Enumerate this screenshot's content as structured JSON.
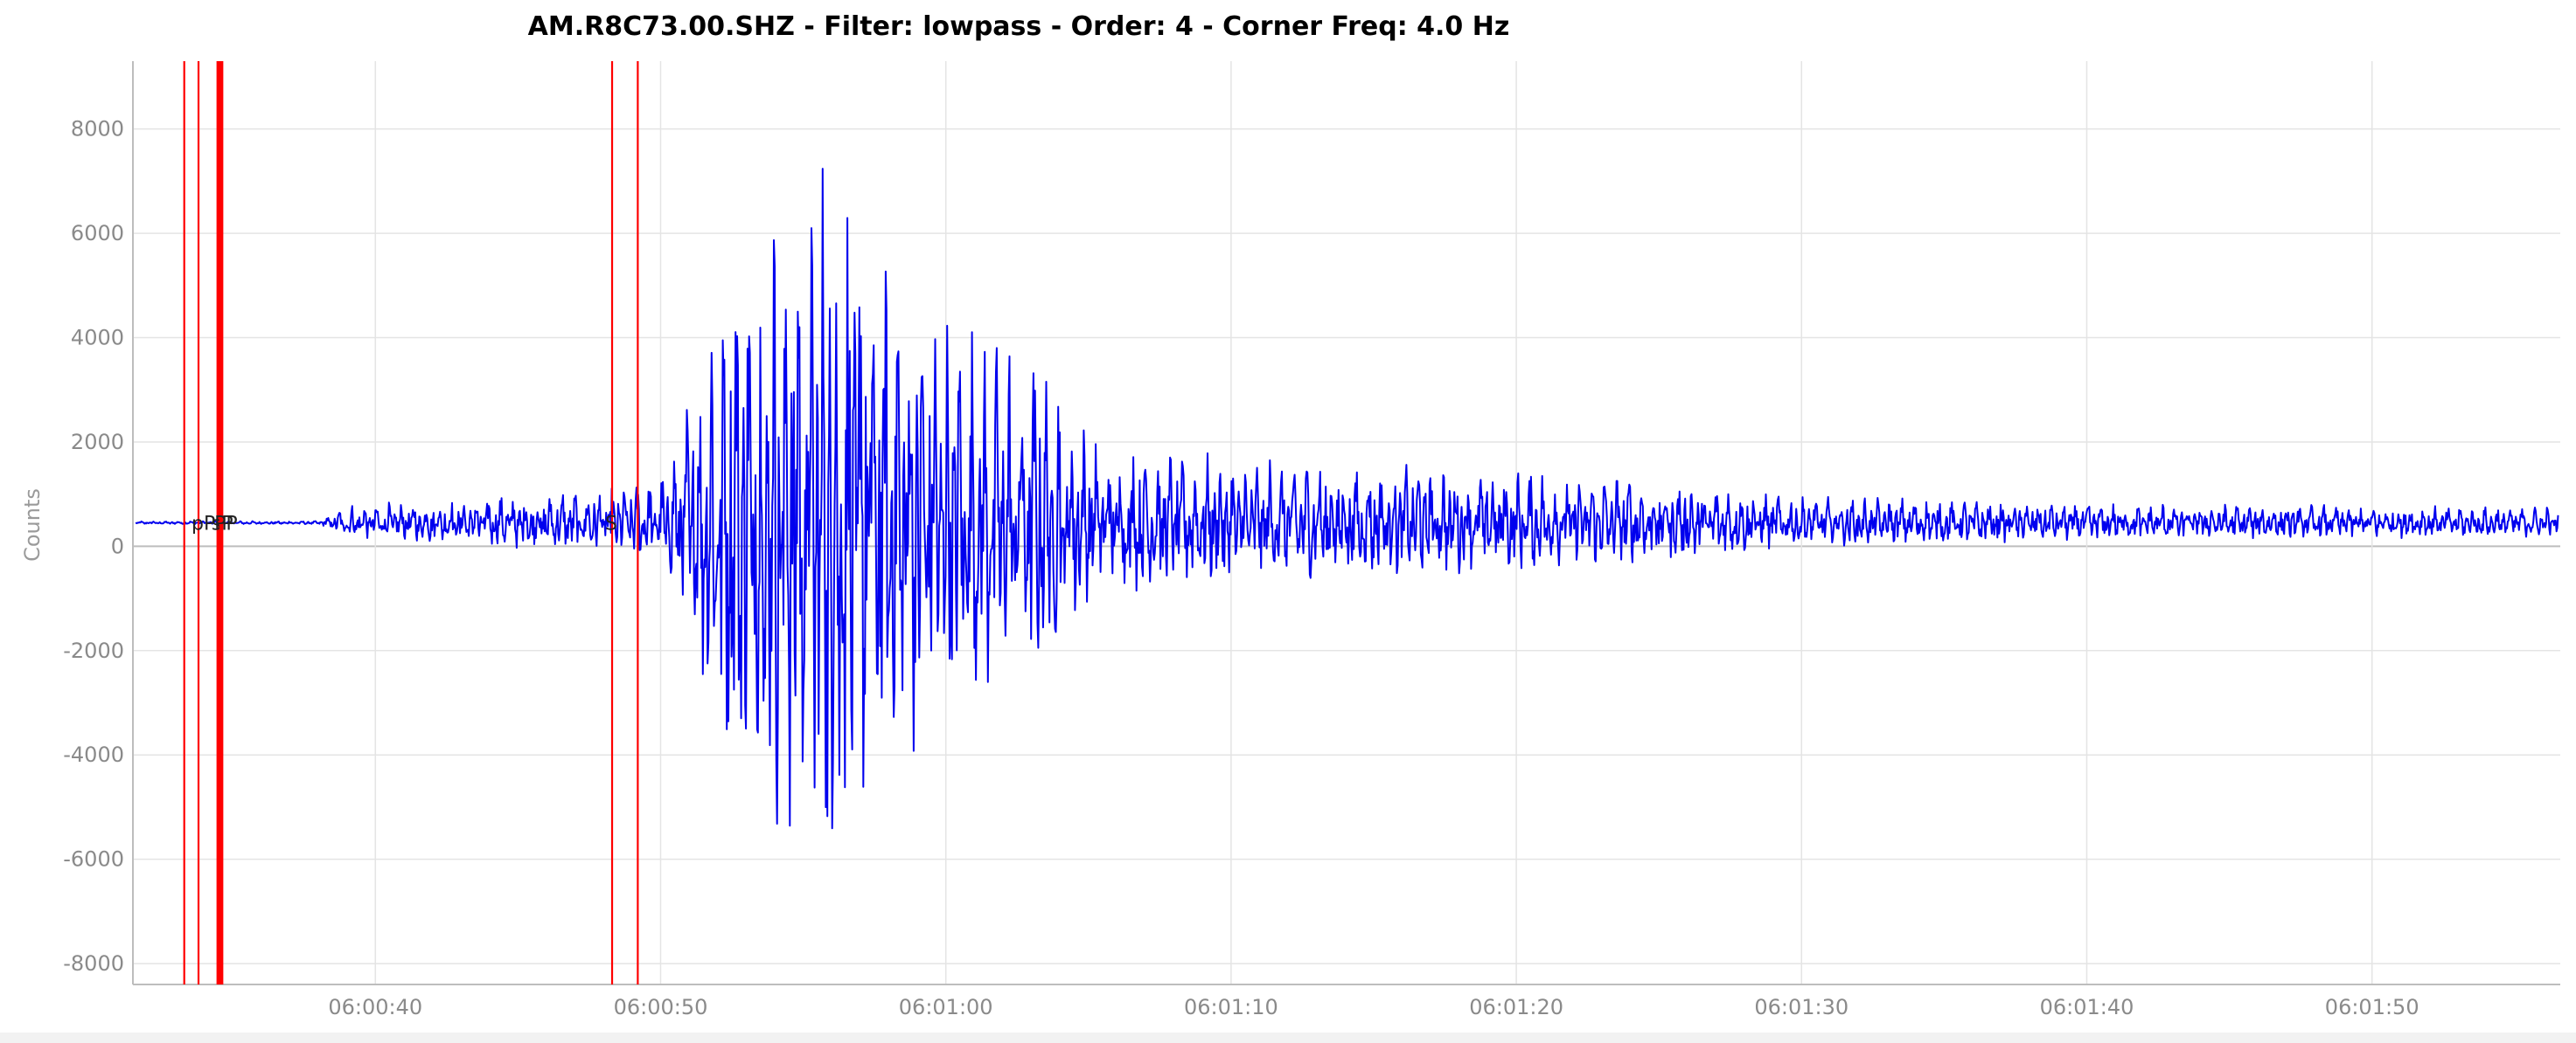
{
  "chart_data": {
    "type": "line",
    "title": "AM.R8C73.00.SHZ - Filter: lowpass - Order: 4 - Corner Freq: 4.0 Hz",
    "ylabel": "Counts",
    "xlabel": "",
    "ylim": [
      -8400,
      9300
    ],
    "xlim_seconds_from_06_00": [
      31.5,
      116.6
    ],
    "x_ticks": [
      "06:00:40",
      "06:00:50",
      "06:01:00",
      "06:01:10",
      "06:01:20",
      "06:01:30",
      "06:01:40",
      "06:01:50"
    ],
    "y_ticks": [
      8000,
      6000,
      4000,
      2000,
      0,
      -2000,
      -4000,
      -6000,
      -8000
    ],
    "grid": true,
    "series": [
      {
        "color": "#0000ee",
        "baseline": 450,
        "envelope": [
          {
            "t": "06:00:31",
            "amp": 30
          },
          {
            "t": "06:00:38",
            "amp": 35
          },
          {
            "t": "06:00:39",
            "amp": 350
          },
          {
            "t": "06:00:47",
            "amp": 650
          },
          {
            "t": "06:00:50",
            "amp": 900
          },
          {
            "t": "06:00:51",
            "amp": 2500
          },
          {
            "t": "06:00:52",
            "amp": 5200
          },
          {
            "t": "06:00:54",
            "amp": 6800
          },
          {
            "t": "06:00:56",
            "amp": 8300
          },
          {
            "t": "06:00:58",
            "amp": 6000
          },
          {
            "t": "06:01:00",
            "amp": 4200
          },
          {
            "t": "06:01:04",
            "amp": 3200
          },
          {
            "t": "06:01:05",
            "amp": 1700
          },
          {
            "t": "06:01:10",
            "amp": 1300
          },
          {
            "t": "06:01:16",
            "amp": 1200
          },
          {
            "t": "06:01:25",
            "amp": 900
          },
          {
            "t": "06:01:30",
            "amp": 550
          },
          {
            "t": "06:01:40",
            "amp": 400
          },
          {
            "t": "06:01:56",
            "amp": 320
          }
        ]
      }
    ],
    "phase_markers": [
      {
        "t": "06:00:33.3",
        "label": "",
        "bold": false
      },
      {
        "t": "06:00:33.8",
        "label": "pP",
        "bold": false
      },
      {
        "t": "06:00:34.5",
        "label": "sP",
        "bold": true
      },
      {
        "t": "06:00:34.6",
        "label": "PP",
        "bold": true
      },
      {
        "t": "06:00:48.3",
        "label": "S",
        "bold": false
      },
      {
        "t": "06:00:49.2",
        "label": "",
        "bold": false
      }
    ]
  }
}
